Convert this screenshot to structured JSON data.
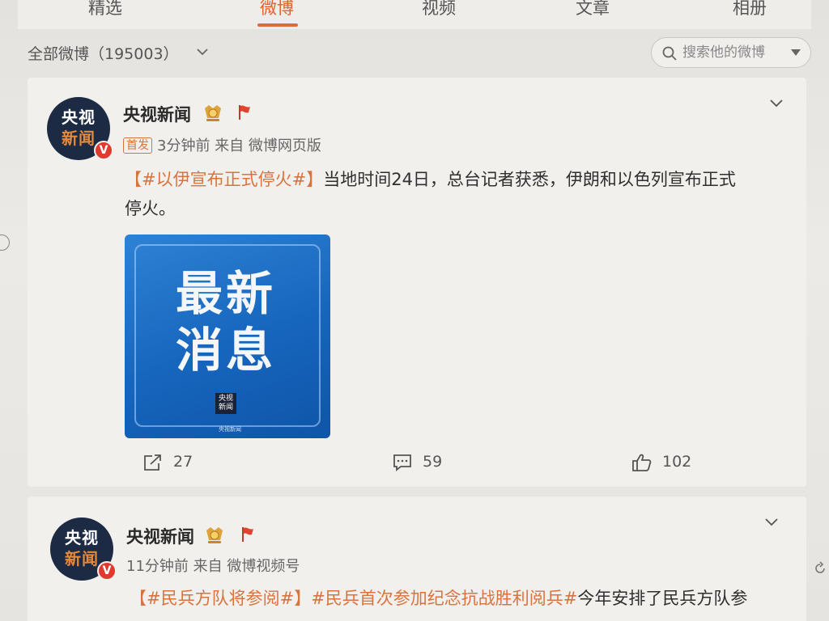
{
  "tabs": [
    {
      "label": "精选",
      "active": false
    },
    {
      "label": "微博",
      "active": true
    },
    {
      "label": "视频",
      "active": false
    },
    {
      "label": "文章",
      "active": false
    },
    {
      "label": "相册",
      "active": false
    }
  ],
  "filter": {
    "label": "全部微博（195003）",
    "search_placeholder": "搜索他的微博"
  },
  "colors": {
    "accent": "#e5683a",
    "hashtag": "#d9733d",
    "verified": "#e03a2e",
    "image_blue": "#1b6cc6"
  },
  "posts": [
    {
      "author": "央视新闻",
      "avatar_text": [
        "央视",
        "新闻"
      ],
      "badge": "V",
      "first_tag": "首发",
      "meta": "3分钟前 来自 微博网页版",
      "hashtag": "【#以伊宣布正式停火#】",
      "text_line1": "当地时间24日，总台记者获悉，伊朗和以色列宣布正式",
      "text_line2": "停火。",
      "image": {
        "big_text_line1": "最新",
        "big_text_line2": "消息",
        "logo_text": "央视新闻",
        "caption": "央视新闻"
      },
      "actions": {
        "share_count": "27",
        "comment_count": "59",
        "like_count": "102"
      }
    },
    {
      "author": "央视新闻",
      "avatar_text": [
        "央视",
        "新闻"
      ],
      "badge": "V",
      "meta": "11分钟前 来自 微博视频号",
      "hashtag1": "【#民兵方队将参阅#】",
      "hashtag2": "#民兵首次参加纪念抗战胜利阅兵#",
      "text_line1": "今年安排了民兵方队参"
    }
  ],
  "icons": [
    "chevron-down-icon",
    "search-icon",
    "medal-icon",
    "flag-icon",
    "share-icon",
    "comment-icon",
    "like-icon"
  ]
}
